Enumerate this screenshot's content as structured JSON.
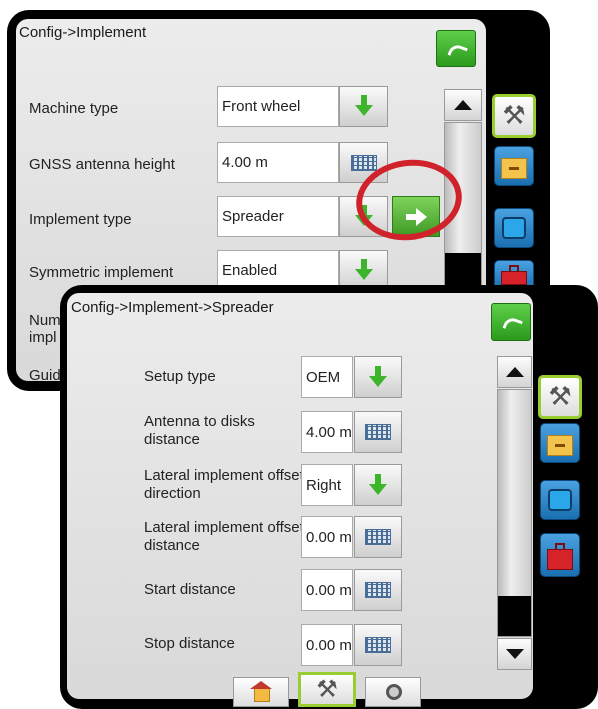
{
  "back_panel": {
    "title": "Config->Implement",
    "rows": [
      {
        "label": "Machine type",
        "value": "Front wheel"
      },
      {
        "label": "GNSS antenna height",
        "value": "4.00 m"
      },
      {
        "label": "Implement type",
        "value": "Spreader"
      },
      {
        "label": "Symmetric implement",
        "value": "Enabled"
      },
      {
        "label": "Num"
      },
      {
        "label": "impl"
      },
      {
        "label": "Guid"
      }
    ]
  },
  "front_panel": {
    "title": "Config->Implement->Spreader",
    "rows": [
      {
        "label": "Setup type",
        "value": "OEM",
        "control": "dropdown"
      },
      {
        "label": "Antenna to disks distance",
        "value": "4.00 m",
        "control": "keypad"
      },
      {
        "label": "Lateral implement offset direction",
        "value": "Right",
        "control": "dropdown"
      },
      {
        "label": "Lateral implement offset distance",
        "value": "0.00 m",
        "control": "keypad"
      },
      {
        "label": "Start distance",
        "value": "0.00 m",
        "control": "keypad"
      },
      {
        "label": "Stop distance",
        "value": "0.00 m",
        "control": "keypad"
      }
    ],
    "bottom_tabs": [
      "home-icon",
      "tools-icon",
      "camera-icon"
    ]
  },
  "side_tabs": [
    "tools-icon",
    "folder-icon",
    "screen-icon",
    "toolbox-icon"
  ],
  "colors": {
    "highlight_circle": "#d0222b",
    "accent_green": "#3cb52a",
    "selected_tab_border": "#9acd32"
  }
}
